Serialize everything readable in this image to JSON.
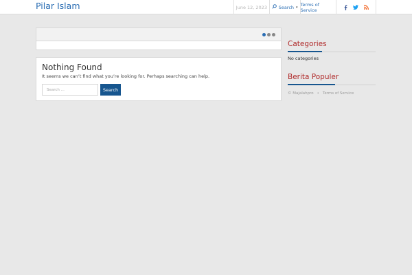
{
  "header": {
    "site_title": "Pilar Islam",
    "date": "June 12, 2023",
    "search_label": "Search",
    "terms_link": "Terms of Service",
    "social_icons": [
      "facebook-icon",
      "twitter-icon",
      "rss-icon"
    ],
    "colors": {
      "brand": "#2a6db3",
      "facebook": "#3b5998",
      "twitter": "#1da1f2",
      "rss": "#f26522"
    }
  },
  "slider": {
    "dots": 3,
    "active_dot": 0
  },
  "main": {
    "title": "Nothing Found",
    "message": "It seems we can’t find what you’re looking for. Perhaps searching can help.",
    "search_placeholder": "Search ...",
    "search_button": "Search"
  },
  "sidebar": {
    "categories_title": "Categories",
    "categories_empty": "No categories",
    "popular_title": "Berita Populer",
    "accent_color": "#b02a2a",
    "rule_color": "#17568f"
  },
  "footer": {
    "copyright": "© Majalahpro",
    "separator": "•",
    "terms_link": "Terms of Service"
  }
}
